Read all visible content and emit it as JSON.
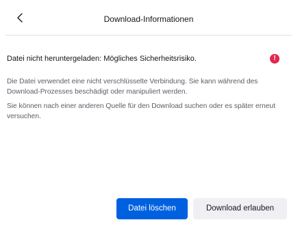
{
  "header": {
    "title": "Download-Informationen",
    "back_icon": "chevron-left-icon"
  },
  "warning": {
    "text": "Datei nicht heruntergeladen: Mögliches Sicherheitsrisiko.",
    "icon": "error-icon",
    "icon_glyph": "!",
    "icon_color": "#e22850"
  },
  "description": {
    "paragraph1": "Die Datei verwendet eine nicht verschlüsselte Verbindung. Sie kann während des Download-Prozesses beschädigt oder manipuliert werden.",
    "paragraph2": "Sie können nach einer anderen Quelle für den Download suchen oder es später erneut versuchen."
  },
  "buttons": {
    "delete_label": "Datei löschen",
    "allow_label": "Download erlauben"
  },
  "colors": {
    "primary": "#0061e0",
    "secondary_bg": "#f0f0f4",
    "text": "#15141a",
    "muted_text": "#5b5b66"
  }
}
